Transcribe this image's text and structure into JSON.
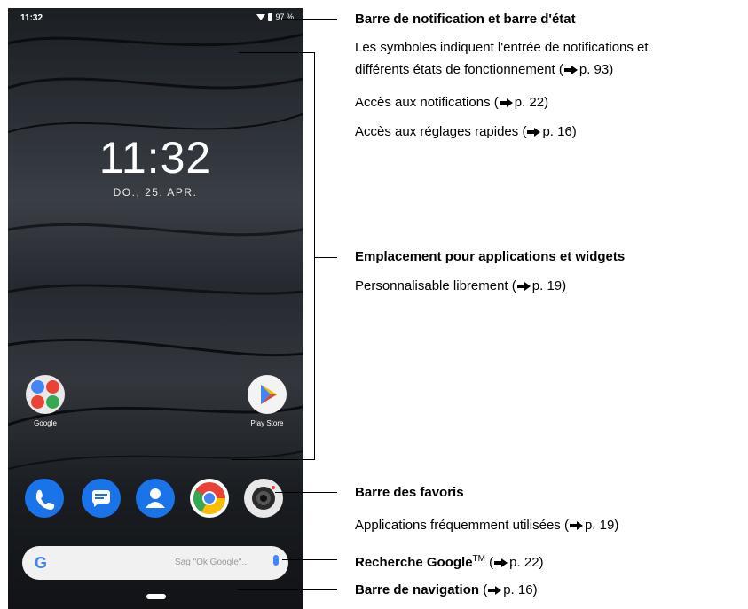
{
  "phone": {
    "status_time": "11:32",
    "battery_text": "97 %",
    "clock": "11:32",
    "date": "DO., 25. APR.",
    "apps": [
      {
        "label": "Google",
        "icon": "google-folder-icon"
      },
      {
        "label": "Play Store",
        "icon": "play-store-icon"
      }
    ],
    "dock": [
      "phone-icon",
      "messages-icon",
      "contacts-icon",
      "chrome-icon",
      "camera-icon"
    ],
    "search": {
      "logo": "G",
      "placeholder": "Sag \"Ok Google\"..."
    }
  },
  "callouts": {
    "status": {
      "title": "Barre de notification et barre d'état",
      "line1": "Les symboles indiquent l'entrée de notifications et",
      "line2_text": "différents états de fonctionnement (",
      "line2_ref": "p. 93)",
      "notif_text": "Accès aux notifications (",
      "notif_ref": "p. 22)",
      "quick_text": "Accès aux réglages rapides (",
      "quick_ref": "p. 16)"
    },
    "apps": {
      "title": "Emplacement pour applications et widgets",
      "text": "Personnalisable librement (",
      "ref": "p. 19)"
    },
    "favorites": {
      "title": "Barre des favoris",
      "text": "Applications fréquemment utilisées (",
      "ref": "p. 19)"
    },
    "search": {
      "title": "Recherche Google",
      "tm": "TM",
      "text": " (",
      "ref": "p. 22)"
    },
    "nav": {
      "title": "Barre de navigation",
      "text": " (",
      "ref": "p. 16)"
    }
  },
  "colors": {
    "google_blue": "#4285F4",
    "google_red": "#EA4335",
    "google_yellow": "#FBBC05",
    "google_green": "#34A853",
    "dock_blue": "#1a73e8"
  }
}
